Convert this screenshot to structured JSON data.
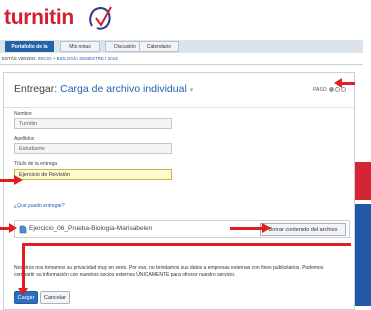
{
  "header": {
    "logo_text": "turnitin"
  },
  "nav": {
    "tabs": [
      {
        "label": "Portafolio de la clase"
      },
      {
        "label": "Mis notas"
      },
      {
        "label": "Discusión"
      },
      {
        "label": "Calendario"
      }
    ]
  },
  "breadcrumb": {
    "prefix": "ESTÁS VIENDO:",
    "path": "INICIO > BIOLOGÍA SEMESTRE I 2018"
  },
  "panel": {
    "title_prefix": "Entregar:",
    "title_highlight": "Carga de archivo individual",
    "step_label": "PASO"
  },
  "form": {
    "first_name_label": "Nombre",
    "first_name_value": "Turnitin",
    "last_name_label": "Apellidos",
    "last_name_value": "Estudiante",
    "title_label": "Título de la entrega",
    "title_value": "Ejercicio de Revisión",
    "help_link": "¿Qué puedo entregar?",
    "file_name": "Ejercicio_06_Prueba-Biología-Marisabelen",
    "remove_button": "Borrar contenido del archivo",
    "privacy_text": "Nosotros nos tomamos su privacidad muy en serio. Por eso, no brindamos sus datos a empresas externas con fines publicitarios. Podemos compartir su información con nuestros socios externos ÚNICAMENTE para ofrecer nuestro servicio.",
    "upload_button": "Cargar",
    "cancel_button": "Cancelar"
  },
  "colors": {
    "brand_red": "#d22030",
    "primary_blue": "#2c6fc0",
    "tab_active": "#2563a8",
    "highlight_yellow": "#fdfacd"
  }
}
